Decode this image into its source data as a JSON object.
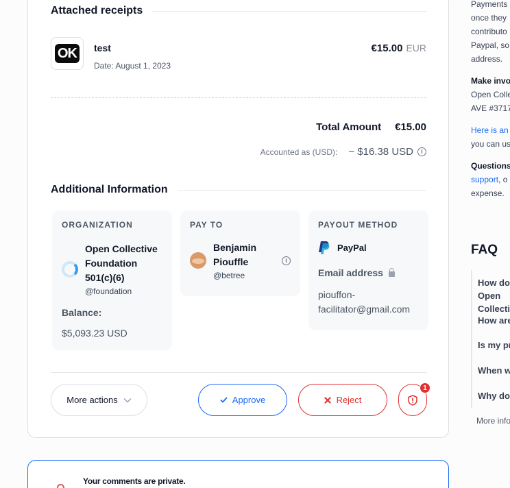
{
  "receipts": {
    "heading": "Attached receipts",
    "item": {
      "thumb_text": "OK",
      "title": "test",
      "date": "Date: August 1, 2023",
      "amount": "€15.00",
      "currency": "EUR"
    }
  },
  "totals": {
    "label": "Total Amount",
    "value": "€15.00",
    "accounted_label": "Accounted as (USD):",
    "accounted_value": "~ $16.38 USD"
  },
  "additional": {
    "heading": "Additional Information",
    "organization": {
      "label": "ORGANIZATION",
      "name": "Open Collective Foundation 501(c)(6)",
      "handle": "@foundation",
      "balance_label": "Balance:",
      "balance_value": "$5,093.23 USD"
    },
    "pay_to": {
      "label": "PAY TO",
      "name": "Benjamin Piouffle",
      "handle": "@betree"
    },
    "payout": {
      "label": "PAYOUT METHOD",
      "method": "PayPal",
      "email_label": "Email address",
      "email_value": "piouffon-facilitator@gmail.com"
    }
  },
  "actions": {
    "more": "More actions",
    "approve": "Approve",
    "reject": "Reject",
    "badge_count": "1"
  },
  "comments": {
    "notice": "Your comments are private."
  },
  "sidebar": {
    "lines": [
      {
        "text": "Payments",
        "style": "normal"
      },
      {
        "text": "once they",
        "style": "normal"
      },
      {
        "text": "contributo",
        "style": "normal"
      },
      {
        "text": "Paypal, so",
        "style": "normal"
      },
      {
        "text": "address.",
        "style": "normal"
      },
      {
        "text": "Make invo",
        "style": "bold"
      },
      {
        "text": "Open Colle",
        "style": "normal"
      },
      {
        "text": "AVE #3717",
        "style": "normal"
      },
      {
        "text": "Here is an",
        "style": "link"
      },
      {
        "text": "you can us",
        "style": "normal"
      },
      {
        "text": "Questions",
        "style": "bold"
      },
      {
        "text": "support, o",
        "style": "mixed"
      },
      {
        "text": "expense.",
        "style": "normal"
      }
    ],
    "faq_title": "FAQ",
    "faq_items": [
      "How do Open Collective",
      "How are",
      "Is my pr",
      "When w",
      "Why do"
    ],
    "more_info": "More info"
  },
  "colors": {
    "accent": "#1869f5",
    "danger": "#e03131",
    "border": "#dcdee3"
  }
}
